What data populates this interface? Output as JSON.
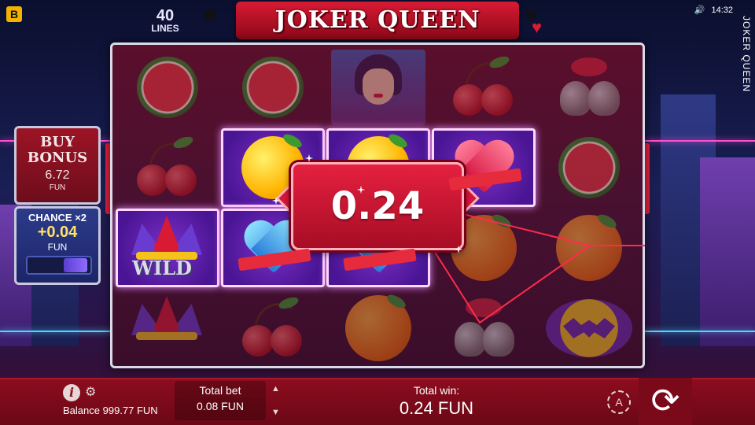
{
  "header": {
    "brand_icon": "B",
    "lines_count": "40",
    "lines_label": "LINES",
    "game_title": "JOKER QUEEN",
    "side_title": "JOKER QUEEN",
    "clock": "14:32",
    "sound_icon": "speaker-icon"
  },
  "left_panel": {
    "buy_bonus": {
      "title": "BUY BONUS",
      "value": "6.72",
      "unit": "FUN"
    },
    "chance": {
      "title": "CHANCE ×2",
      "value": "+0.04",
      "unit": "FUN"
    }
  },
  "reels": {
    "columns": [
      [
        "watermelon",
        "cherries",
        "jester-wild",
        "jester-hat"
      ],
      [
        "watermelon",
        "lemon",
        "blue-heart",
        "cherries"
      ],
      [
        "joker-queen",
        "lemon",
        "blue-heart",
        "orange"
      ],
      [
        "cherries",
        "red-heart",
        "orange",
        "bells"
      ],
      [
        "bells",
        "watermelon",
        "orange",
        "bat-emblem"
      ]
    ],
    "wild_label": "WILD"
  },
  "win_display": {
    "value": "0.24"
  },
  "bottom_bar": {
    "balance_label": "Balance",
    "balance_value": "999.77 FUN",
    "total_bet_label": "Total bet",
    "total_bet_value": "0.08 FUN",
    "total_win_label": "Total win:",
    "total_win_value": "0.24 FUN",
    "auto_label": "A"
  }
}
